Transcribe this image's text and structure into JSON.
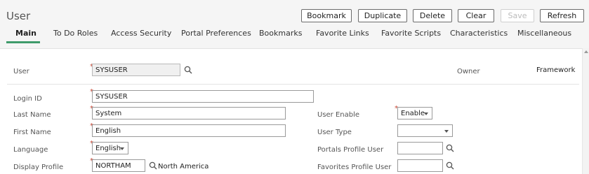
{
  "page": {
    "title": "User"
  },
  "toolbar": {
    "bookmark": "Bookmark",
    "duplicate": "Duplicate",
    "delete": "Delete",
    "clear": "Clear",
    "save": "Save",
    "refresh": "Refresh"
  },
  "tabs": [
    {
      "label": "Main",
      "active": true
    },
    {
      "label": "To Do Roles"
    },
    {
      "label": "Access Security"
    },
    {
      "label": "Portal Preferences"
    },
    {
      "label": "Bookmarks"
    },
    {
      "label": "Favorite Links"
    },
    {
      "label": "Favorite Scripts"
    },
    {
      "label": "Characteristics"
    },
    {
      "label": "Miscellaneous"
    }
  ],
  "form": {
    "user_label": "User",
    "user_value": "SYSUSER",
    "owner_label": "Owner",
    "owner_value": "Framework",
    "login_id_label": "Login ID",
    "login_id_value": "SYSUSER",
    "last_name_label": "Last Name",
    "last_name_value": "System",
    "first_name_label": "First Name",
    "first_name_value": "English",
    "language_label": "Language",
    "language_value": "English",
    "display_profile_label": "Display Profile",
    "display_profile_value": "NORTHAM",
    "display_profile_desc": "North America",
    "user_enable_label": "User Enable",
    "user_enable_value": "Enable",
    "user_type_label": "User Type",
    "user_type_value": "",
    "portals_profile_label": "Portals Profile User",
    "portals_profile_value": "",
    "favorites_profile_label": "Favorites Profile User",
    "favorites_profile_value": ""
  },
  "colors": {
    "accent": "#3f9b6b",
    "required": "#c74634"
  }
}
